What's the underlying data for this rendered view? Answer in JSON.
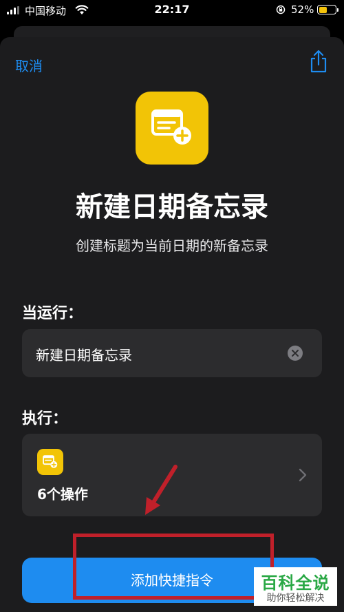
{
  "status_bar": {
    "carrier": "中国移动",
    "time": "22:17",
    "battery_percent": "52%",
    "battery_level": 0.52,
    "battery_color": "#f4c30a"
  },
  "header": {
    "cancel_label": "取消",
    "share_icon": "share-icon"
  },
  "shortcut": {
    "icon": "note-add-icon",
    "icon_color": "#f2c406",
    "title": "新建日期备忘录",
    "subtitle": "创建标题为当前日期的新备忘录"
  },
  "when_run": {
    "label": "当运行：",
    "name_value": "新建日期备忘录",
    "clear_icon": "clear-icon"
  },
  "actions": {
    "label": "执行：",
    "count_label": "6个操作",
    "chevron_icon": "chevron-right-icon"
  },
  "add_button": {
    "label": "添加快捷指令",
    "color": "#1e8cf0"
  },
  "watermark": {
    "title": "百科全说",
    "subtitle": "助你轻松解决"
  },
  "accent_color": "#1e8cf0",
  "annotation_color": "#c0202a"
}
